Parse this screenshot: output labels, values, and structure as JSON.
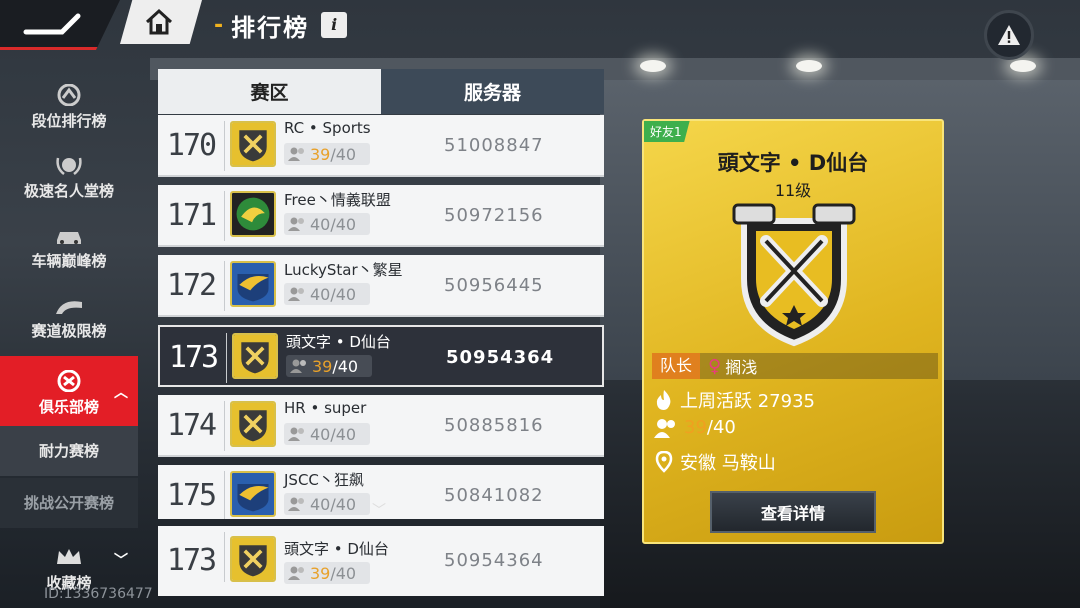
{
  "header": {
    "title": "排行榜",
    "info_icon": "i"
  },
  "sidebar": {
    "items": [
      {
        "label": "段位排行榜",
        "icon": "rank-icon"
      },
      {
        "label": "极速名人堂榜",
        "icon": "laurel-icon"
      },
      {
        "label": "车辆巅峰榜",
        "icon": "car-icon"
      },
      {
        "label": "赛道极限榜",
        "icon": "track-icon"
      },
      {
        "label": "俱乐部榜",
        "icon": "club-icon",
        "active": true
      },
      {
        "label": "耐力赛榜",
        "sub": true
      },
      {
        "label": "挑战公开赛榜",
        "sub": true
      },
      {
        "label": "收藏榜",
        "icon": "crown-icon"
      }
    ],
    "user_id": "ID:1336736477"
  },
  "tabs": [
    {
      "label": "赛区",
      "active": true
    },
    {
      "label": "服务器",
      "active": false
    }
  ],
  "rows": [
    {
      "rank": "170",
      "name": "RC • Sports",
      "current": "39",
      "sep": "/",
      "max": "40",
      "server": "51008847",
      "badge": "wrench-shield",
      "highlight": true,
      "selected": false
    },
    {
      "rank": "171",
      "name": "Free丶情義联盟",
      "current": "40",
      "sep": "/",
      "max": "40",
      "server": "50972156",
      "badge": "dragon",
      "highlight": false,
      "selected": false
    },
    {
      "rank": "172",
      "name": "LuckyStar丶繁星",
      "current": "40",
      "sep": "/",
      "max": "40",
      "server": "50956445",
      "badge": "eagle",
      "highlight": false,
      "selected": false
    },
    {
      "rank": "173",
      "name": "頭文字 • D仙台",
      "current": "39",
      "sep": "/",
      "max": "40",
      "server": "50954364",
      "badge": "wrench-shield",
      "highlight": true,
      "selected": true
    },
    {
      "rank": "174",
      "name": "HR • super",
      "current": "40",
      "sep": "/",
      "max": "40",
      "server": "50885816",
      "badge": "wrench-shield",
      "highlight": false,
      "selected": false
    },
    {
      "rank": "175",
      "name": "JSCC丶狂飙",
      "current": "40",
      "sep": "/",
      "max": "40",
      "server": "50841082",
      "badge": "eagle",
      "highlight": false,
      "selected": false
    }
  ],
  "my_club": {
    "rank": "173",
    "name": "頭文字 • D仙台",
    "current": "39",
    "sep": "/",
    "max": "40",
    "server": "50954364"
  },
  "card": {
    "friend_tag": "好友1",
    "name": "頭文字 • D仙台",
    "level": "11级",
    "leader_tag": "队长",
    "leader_gender": "♀",
    "leader_name": "搁浅",
    "activity": "上周活跃 27935",
    "members_current": "39",
    "members_rest": "/40",
    "location": "安徽 马鞍山",
    "detail_button": "查看详情"
  },
  "colors": {
    "accent": "#e31e26",
    "gold": "#e0b520",
    "highlight": "#e8a12a"
  }
}
